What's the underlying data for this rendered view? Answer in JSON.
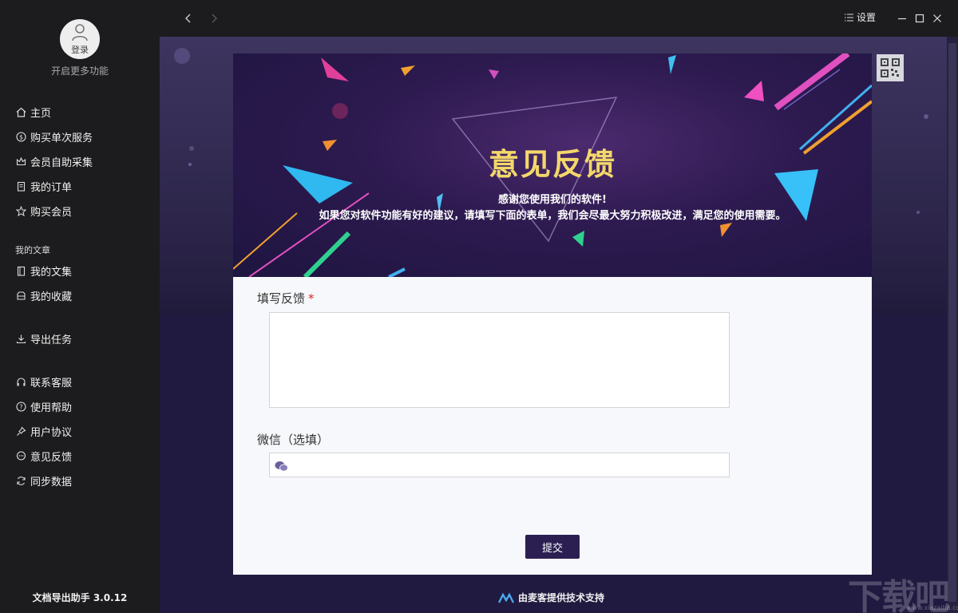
{
  "sidebar": {
    "login_label": "登录",
    "more_features": "开启更多功能",
    "items": [
      {
        "label": "主页",
        "icon": "home-icon"
      },
      {
        "label": "购买单次服务",
        "icon": "dollar-icon"
      },
      {
        "label": "会员自助采集",
        "icon": "crown-icon"
      },
      {
        "label": "我的订单",
        "icon": "order-icon"
      },
      {
        "label": "购买会员",
        "icon": "vip-icon"
      }
    ],
    "section_articles": "我的文章",
    "article_items": [
      {
        "label": "我的文集",
        "icon": "book-icon"
      },
      {
        "label": "我的收藏",
        "icon": "bookmark-icon"
      }
    ],
    "export_item": {
      "label": "导出任务",
      "icon": "download-icon"
    },
    "help_items": [
      {
        "label": "联系客服",
        "icon": "headset-icon"
      },
      {
        "label": "使用帮助",
        "icon": "question-icon"
      },
      {
        "label": "用户协议",
        "icon": "pin-icon"
      },
      {
        "label": "意见反馈",
        "icon": "chat-icon"
      },
      {
        "label": "同步数据",
        "icon": "sync-icon"
      }
    ],
    "version": "文档导出助手 3.0.12"
  },
  "topbar": {
    "settings_label": "设置"
  },
  "banner": {
    "title": "意见反馈",
    "subtitle1": "感谢您使用我们的软件!",
    "subtitle2": "如果您对软件功能有好的建议，请填写下面的表单，我们会尽最大努力积极改进，满足您的使用需要。"
  },
  "form": {
    "feedback_label": "填写反馈",
    "required_mark": "*",
    "feedback_value": "",
    "wechat_label": "微信（选填）",
    "wechat_value": "",
    "submit_label": "提交"
  },
  "footer": {
    "powered_by": "由麦客提供技术支持"
  },
  "watermark": {
    "text": "下载吧",
    "url": "www.xiazaiba.com"
  },
  "colors": {
    "sidebar_bg": "#1c1c1e",
    "banner_title": "#f3d86a",
    "submit_bg": "#2b1f52",
    "main_bg": "#201a40"
  }
}
